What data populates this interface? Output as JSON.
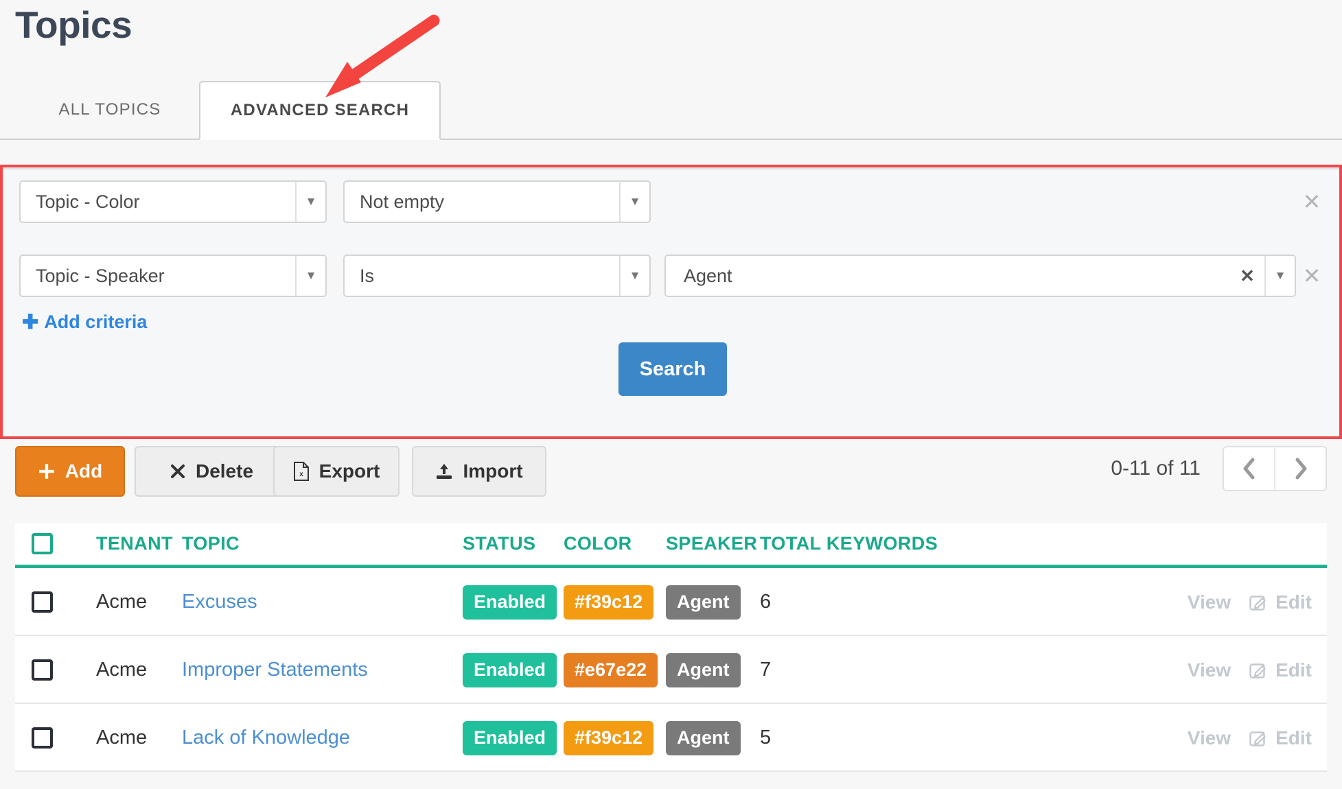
{
  "page": {
    "title": "Topics"
  },
  "tabs": [
    {
      "label": "ALL TOPICS",
      "active": false
    },
    {
      "label": "ADVANCED SEARCH",
      "active": true
    }
  ],
  "advanced_search": {
    "highlight_color": "#f0484a",
    "criteria": [
      {
        "field": "Topic - Color",
        "operator": "Not empty",
        "value": null,
        "remove_icon": "close-icon"
      },
      {
        "field": "Topic - Speaker",
        "operator": "Is",
        "value": "Agent",
        "remove_icon": "close-icon"
      }
    ],
    "add_criteria_label": "Add criteria",
    "add_criteria_plus": "✚",
    "search_button_label": "Search",
    "search_button_color": "#3c87c8"
  },
  "toolbar": {
    "add_label": "Add",
    "delete_label": "Delete",
    "export_label": "Export",
    "import_label": "Import",
    "add_color": "#e8801d"
  },
  "pagination": {
    "range_label": "0-11 of 11",
    "prev_icon": "chevron-left-icon",
    "next_icon": "chevron-right-icon"
  },
  "table": {
    "accent_color": "#1aa98c",
    "columns": [
      "TENANT",
      "TOPIC",
      "STATUS",
      "COLOR",
      "SPEAKER",
      "TOTAL KEYWORDS"
    ],
    "action_labels": {
      "view": "View",
      "edit": "Edit"
    },
    "rows": [
      {
        "tenant": "Acme",
        "topic": "Excuses",
        "status": "Enabled",
        "color": "#f39c12",
        "speaker": "Agent",
        "total_keywords": "6"
      },
      {
        "tenant": "Acme",
        "topic": "Improper Statements",
        "status": "Enabled",
        "color": "#e67e22",
        "speaker": "Agent",
        "total_keywords": "7"
      },
      {
        "tenant": "Acme",
        "topic": "Lack of Knowledge",
        "status": "Enabled",
        "color": "#f39c12",
        "speaker": "Agent",
        "total_keywords": "5"
      }
    ]
  },
  "annotation": {
    "arrow_color": "#f4443f",
    "arrow_target": "ADVANCED SEARCH tab"
  }
}
